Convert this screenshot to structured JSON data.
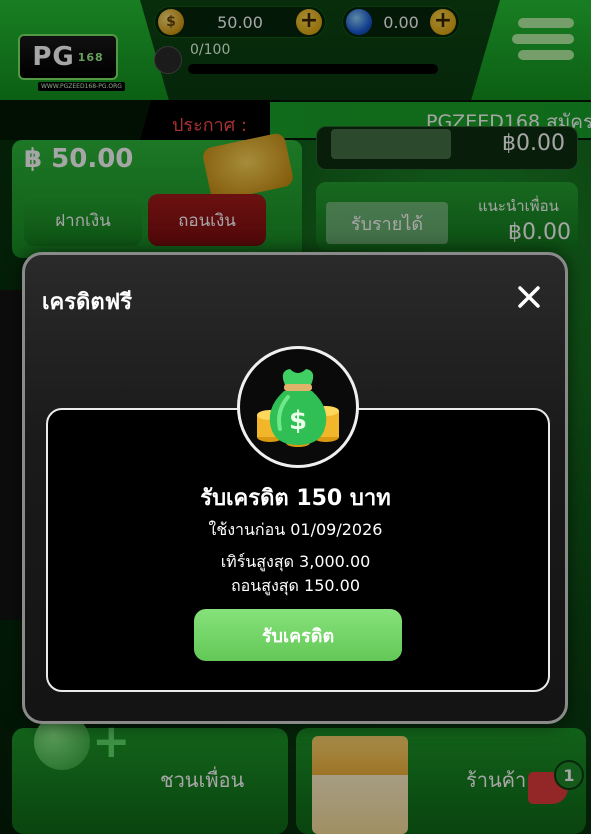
{
  "header": {
    "logo_text": "PG",
    "logo_sub": "168",
    "logo_caption": "WWW.PGZEED168-PG.ORG",
    "coin_symbol": "$",
    "gold_balance": "50.00",
    "gem_balance": "0.00",
    "level_progress": "0/100"
  },
  "announcement": {
    "label": "ประกาศ :",
    "text": "PGZEED168 สมัคร"
  },
  "balance": {
    "amount": "฿ 50.00",
    "deposit_label": "ฝากเงิน",
    "withdraw_label": "ถอนเงิน"
  },
  "right_top": {
    "value": "฿0.00"
  },
  "referral": {
    "button_label": "รับรายได้",
    "label": "แนะนำเพื่อน",
    "value": "฿0.00"
  },
  "bottom_nav": {
    "invite_label": "ชวนเพื่อน",
    "shop_label": "ร้านค้า",
    "notification_count": "1"
  },
  "modal": {
    "title": "เครดิตฟรี",
    "reward_title": "รับเครดิต 150 บาท",
    "expiry": "ใช้งานก่อน 01/09/2026",
    "turnover": "เทิร์นสูงสุด 3,000.00",
    "max_withdraw": "ถอนสูงสุด 150.00",
    "claim_label": "รับเครดิต"
  },
  "icons": {
    "close": "close-icon",
    "money_bag": "money-bag-icon",
    "menu": "hamburger-menu-icon"
  },
  "colors": {
    "primary_green": "#1aa52a",
    "claim_green": "#75d669",
    "withdraw_red": "#8f1414",
    "announce_red": "#ff4d4d"
  }
}
